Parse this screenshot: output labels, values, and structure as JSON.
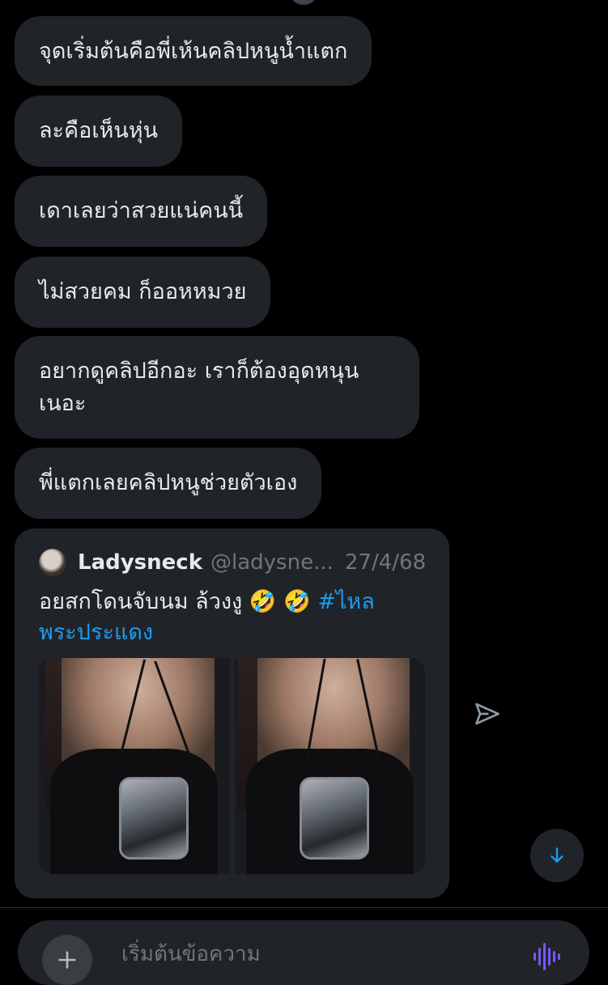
{
  "messages": [
    {
      "text": "จุดเริ่มต้นคือพี่เห้นคลิปหนูน้ำแตก"
    },
    {
      "text": "ละคือเห็นหุ่น"
    },
    {
      "text": "เดาเลยว่าสวยแน่คนนี้"
    },
    {
      "text": "ไม่สวยคม ก็ออหหมวย"
    },
    {
      "text": "อยากดูคลิปอีกอะ เราก็ต้องอุดหนุน เนอะ"
    },
    {
      "text": "พี่แตกเลยคลิปหนูช่วยตัวเอง"
    }
  ],
  "quoted_post": {
    "name": "Ladysneck",
    "handle": "@ladysne...",
    "date": "27/4/68",
    "text": "อยสกโดนจับนม ล้วงงู 🤣 🤣",
    "hashtag": "#ไหลพระประแดง"
  },
  "composer": {
    "placeholder": "เริ่มต้นข้อความ"
  },
  "icons": {
    "send": "send-icon",
    "scroll_down": "arrow-down-icon",
    "add": "plus-icon",
    "voice": "voice-wave-icon"
  },
  "colors": {
    "background": "#000000",
    "bubble": "#202327",
    "accent": "#1d9bf0",
    "voice": "#7856ff"
  }
}
